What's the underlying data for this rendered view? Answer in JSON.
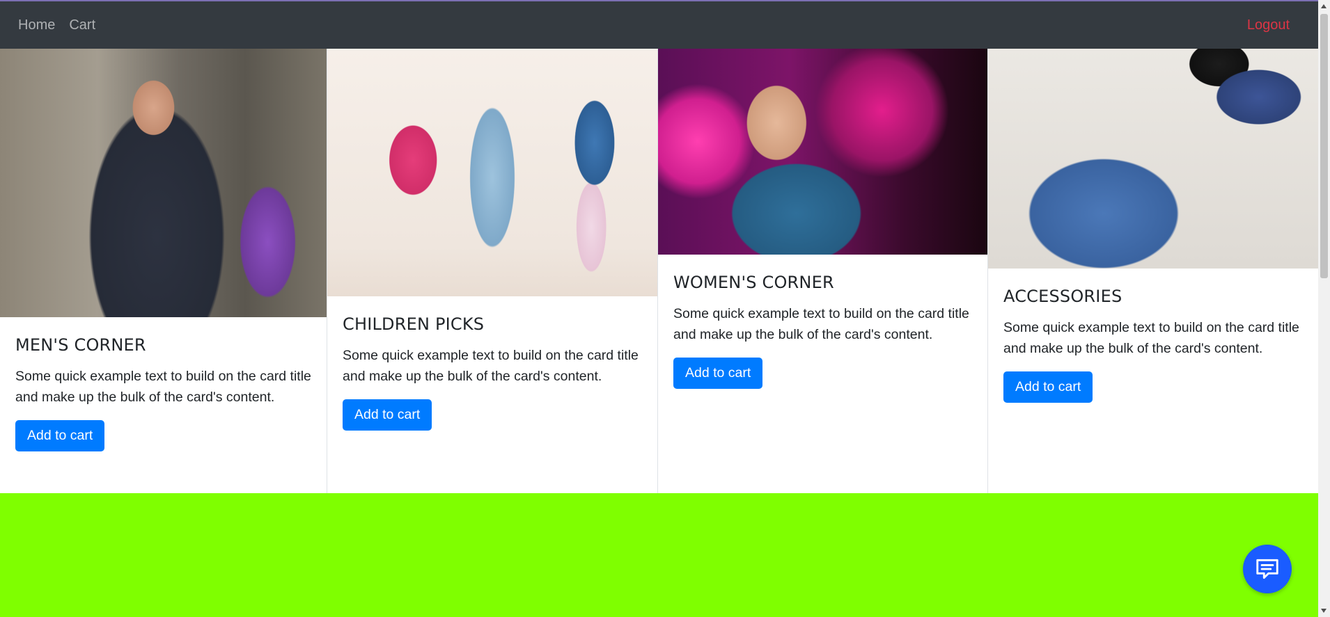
{
  "nav": {
    "home": "Home",
    "cart": "Cart",
    "logout": "Logout"
  },
  "cards": [
    {
      "title": "MEN'S CORNER",
      "text": "Some quick example text to build on the card title and make up the bulk of the card's content.",
      "button": "Add to cart",
      "image": "men-photo"
    },
    {
      "title": "CHILDREN PICKS",
      "text": "Some quick example text to build on the card title and make up the bulk of the card's content.",
      "button": "Add to cart",
      "image": "children-photo"
    },
    {
      "title": "WOMEN'S CORNER",
      "text": "Some quick example text to build on the card title and make up the bulk of the card's content.",
      "button": "Add to cart",
      "image": "women-photo"
    },
    {
      "title": "ACCESSORIES",
      "text": "Some quick example text to build on the card title and make up the bulk of the card's content.",
      "button": "Add to cart",
      "image": "accessories-photo"
    }
  ],
  "chat": {
    "icon": "chat-icon"
  },
  "colors": {
    "navbar": "#343a40",
    "logout": "#dc3545",
    "button": "#007bff",
    "page_background": "#7fff00",
    "chat_button": "#1a5cff"
  }
}
